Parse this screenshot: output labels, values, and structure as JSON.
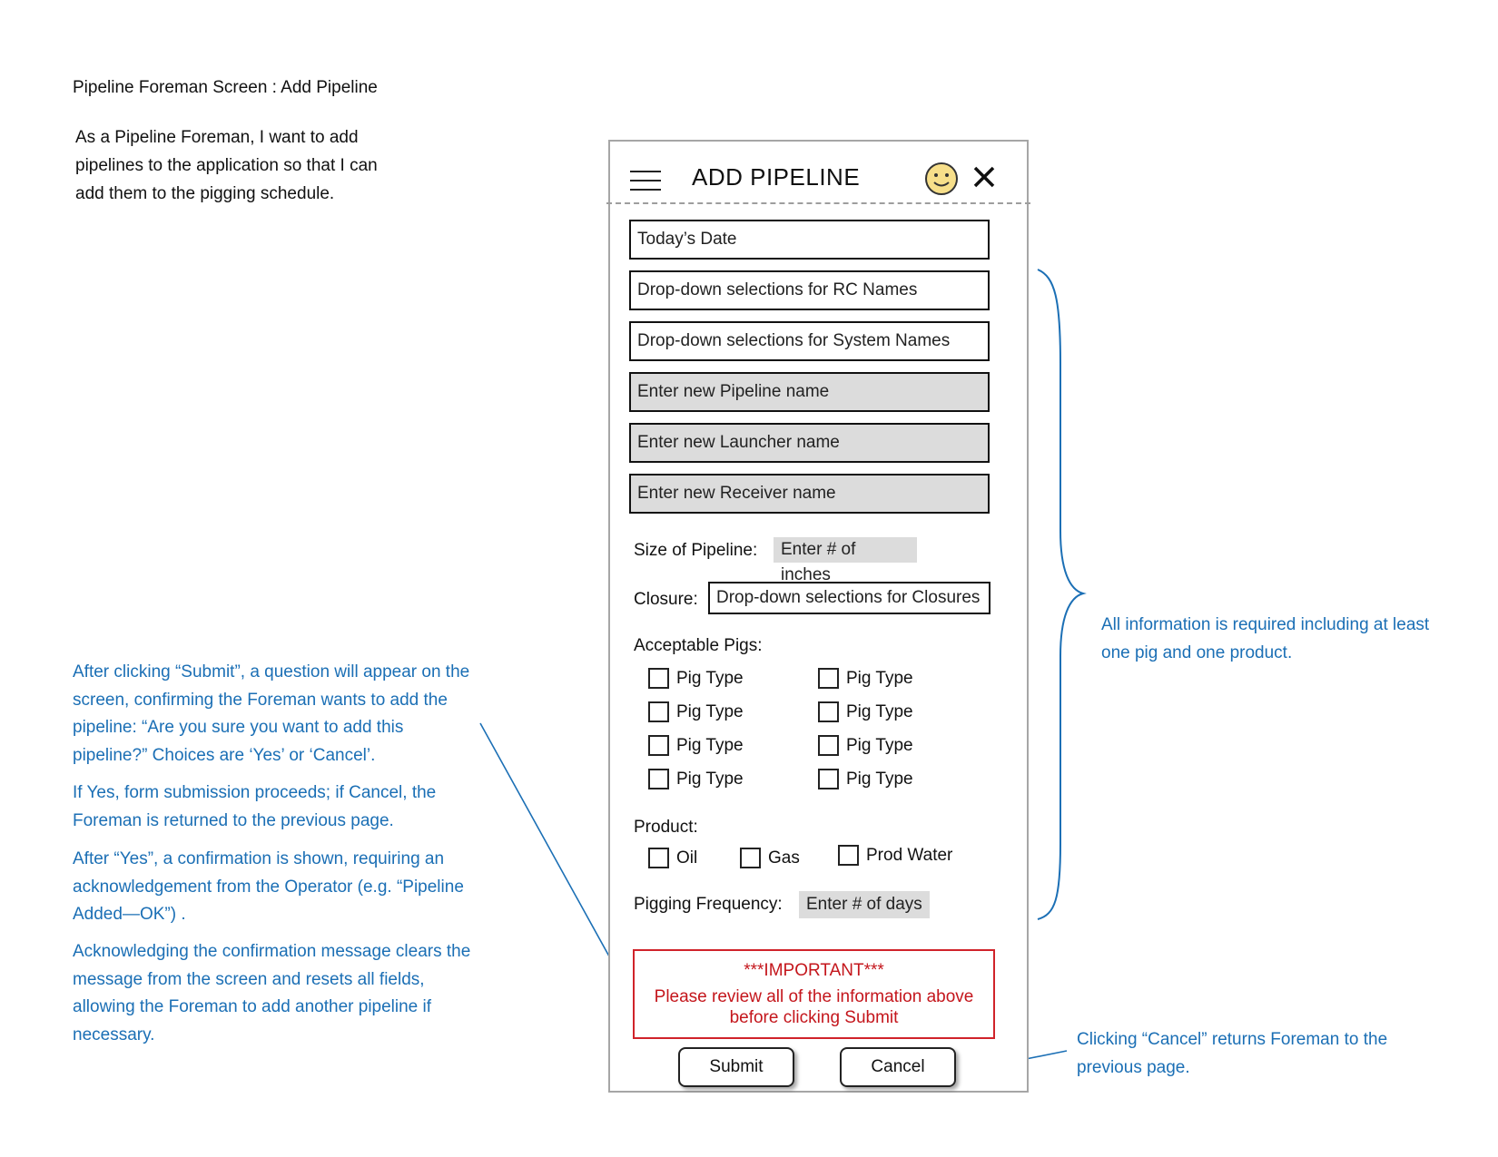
{
  "page": {
    "title": "Pipeline Foreman Screen : Add Pipeline",
    "story": "As a Pipeline Foreman, I want to add pipelines to the application so that I can add them to the pigging schedule."
  },
  "notes": {
    "left": [
      "After clicking “Submit”,  a question will appear on the screen,  confirming the Foreman wants to add the pipeline:  “Are you sure you want to add this pipeline?”   Choices are ‘Yes’ or ‘Cancel’.",
      "If Yes, form submission proceeds; if Cancel, the Foreman is returned to the previous page.",
      "After “Yes”, a confirmation is shown, requiring  an acknowledgement from the Operator (e.g. “Pipeline Added—OK”) .",
      "Acknowledging the confirmation message clears the message from the screen and resets all fields, allowing the Foreman to add another pipeline if necessary."
    ],
    "right_required": "All information is required including at least one pig and one product.",
    "right_cancel": "Clicking “Cancel” returns Foreman to the previous page."
  },
  "form": {
    "header_title": "ADD PIPELINE",
    "menu_icon": "hamburger-menu-icon",
    "profile_icon": "smiley-face-icon",
    "close_icon": "close-x-icon",
    "fields": {
      "date": "Today’s Date",
      "rc": "Drop-down selections for RC Names",
      "system": "Drop-down selections for System Names",
      "pipeline": "Enter new Pipeline name",
      "launcher": "Enter new Launcher name",
      "receiver": "Enter new Receiver name"
    },
    "size_label": "Size of Pipeline:",
    "size_value": "Enter # of inches",
    "closure_label": "Closure:",
    "closure_value": "Drop-down selections for Closures",
    "pigs_label": "Acceptable Pigs:",
    "pigs": [
      "Pig Type",
      "Pig Type",
      "Pig Type",
      "Pig Type",
      "Pig Type",
      "Pig Type",
      "Pig Type",
      "Pig Type"
    ],
    "product_label": "Product:",
    "products": [
      "Oil",
      "Gas",
      "Prod Water"
    ],
    "frequency_label": "Pigging Frequency:",
    "frequency_value": "Enter # of days",
    "important_title": "***IMPORTANT***",
    "important_line1": "Please review all of the information above",
    "important_line2": "before clicking  Submit",
    "submit_label": "Submit",
    "cancel_label": "Cancel"
  },
  "colors": {
    "note_blue": "#1b6fb5",
    "important_red": "#c4161c",
    "field_gray": "#dcdcdc"
  }
}
